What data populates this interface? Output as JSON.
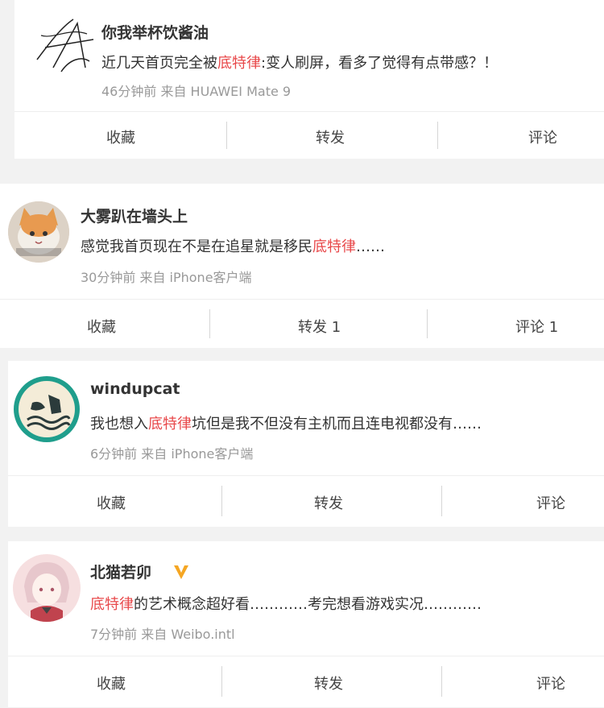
{
  "posts": [
    {
      "user": "你我举杯饮酱油",
      "text_before": "近几天首页完全被",
      "highlight": "底特律",
      "text_after": ":变人刷屏，看多了觉得有点带感？！",
      "meta": "46分钟前 来自 HUAWEI Mate 9",
      "actions": {
        "collect": "收藏",
        "forward": "转发",
        "comment": "评论"
      }
    },
    {
      "user": "大雾趴在墙头上",
      "text_before": "感觉我首页现在不是在追星就是移民",
      "highlight": "底特律",
      "text_after": "……",
      "meta": "30分钟前 来自 iPhone客户端",
      "actions": {
        "collect": "收藏",
        "forward": "转发 1",
        "comment": "评论 1"
      }
    },
    {
      "user": "windupcat",
      "text_before": "我也想入",
      "highlight": "底特律",
      "text_after": "坑但是我不但没有主机而且连电视都没有……",
      "meta": "6分钟前 来自 iPhone客户端",
      "actions": {
        "collect": "收藏",
        "forward": "转发",
        "comment": "评论"
      }
    },
    {
      "user": "北猫若卯",
      "text_before": "",
      "highlight": "底特律",
      "text_after": "的艺术概念超好看…………考完想看游戏实况…………",
      "meta": "7分钟前 来自 Weibo.intl",
      "actions": {
        "collect": "收藏",
        "forward": "转发",
        "comment": "评论"
      }
    }
  ],
  "colors": {
    "highlight": "#e8484a",
    "verified": "#f5a623"
  },
  "icons": [
    "signature-avatar",
    "cat-avatar",
    "hand-wave-avatar",
    "anime-girl-avatar",
    "verified-v-icon"
  ]
}
